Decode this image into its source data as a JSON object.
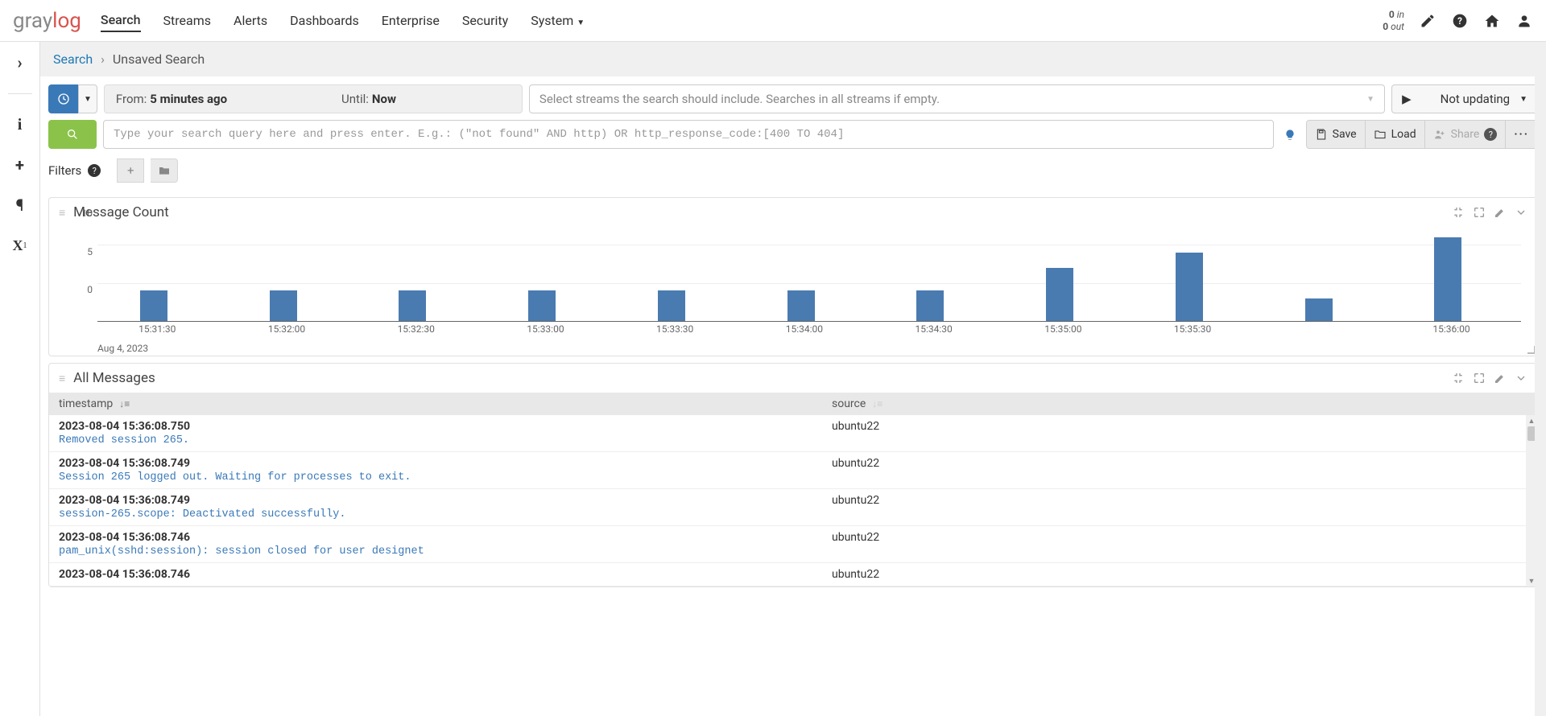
{
  "header": {
    "logo_gray": "gray",
    "logo_log": "log",
    "nav": [
      "Search",
      "Streams",
      "Alerts",
      "Dashboards",
      "Enterprise",
      "Security",
      "System"
    ],
    "active_nav": "Search",
    "throughput_in_count": "0",
    "throughput_in_label": "in",
    "throughput_out_count": "0",
    "throughput_out_label": "out"
  },
  "breadcrumb": {
    "root": "Search",
    "current": "Unsaved Search"
  },
  "timerange": {
    "from_label": "From:",
    "from_value": "5 minutes ago",
    "until_label": "Until:",
    "until_value": "Now"
  },
  "streams_placeholder": "Select streams the search should include. Searches in all streams if empty.",
  "refresh_label": "Not updating",
  "query_placeholder": "Type your search query here and press enter. E.g.: (\"not found\" AND http) OR http_response_code:[400 TO 404]",
  "actions": {
    "save": "Save",
    "load": "Load",
    "share": "Share"
  },
  "filters_label": "Filters",
  "panels": {
    "message_count_title": "Message Count",
    "all_messages_title": "All Messages"
  },
  "chart_data": {
    "type": "bar",
    "categories": [
      "15:31:30",
      "15:32:00",
      "15:32:30",
      "15:33:00",
      "15:33:30",
      "15:34:00",
      "15:34:30",
      "15:35:00",
      "15:35:30",
      "",
      "15:36:00"
    ],
    "values": [
      4,
      4,
      4,
      4,
      4,
      4,
      4,
      7,
      9,
      3,
      11
    ],
    "date_label": "Aug 4, 2023",
    "ylabel": "",
    "xlabel": "",
    "ylim": [
      0,
      12
    ],
    "yticks": [
      0,
      5,
      10
    ]
  },
  "table": {
    "columns": {
      "timestamp": "timestamp",
      "source": "source"
    },
    "rows": [
      {
        "ts": "2023-08-04 15:36:08.750",
        "msg": "Removed session 265.",
        "src": "ubuntu22"
      },
      {
        "ts": "2023-08-04 15:36:08.749",
        "msg": "Session 265 logged out. Waiting for processes to exit.",
        "src": "ubuntu22"
      },
      {
        "ts": "2023-08-04 15:36:08.749",
        "msg": "session-265.scope: Deactivated successfully.",
        "src": "ubuntu22"
      },
      {
        "ts": "2023-08-04 15:36:08.746",
        "msg": "pam_unix(sshd:session): session closed for user designet",
        "src": "ubuntu22"
      },
      {
        "ts": "2023-08-04 15:36:08.746",
        "msg": "",
        "src": "ubuntu22"
      }
    ]
  }
}
